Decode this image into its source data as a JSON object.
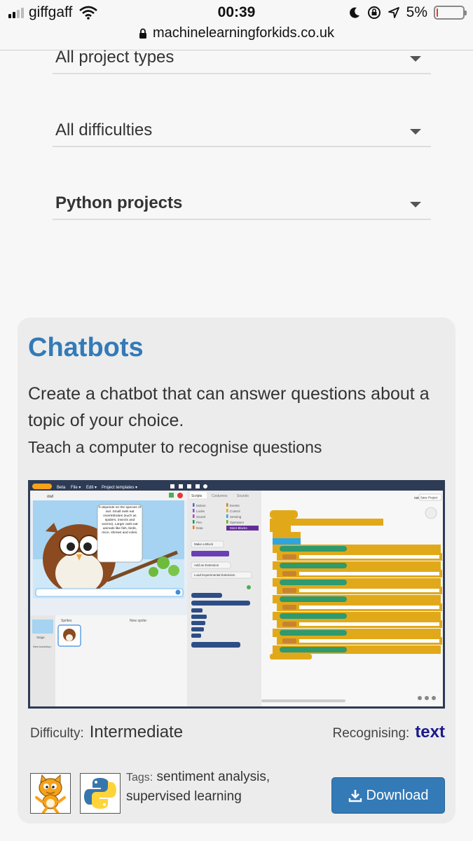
{
  "status": {
    "carrier": "giffgaff",
    "time": "00:39",
    "battery": "5%",
    "battery_level": 0.05,
    "url": "machinelearningforkids.co.uk"
  },
  "filters": [
    {
      "label": "All project types"
    },
    {
      "label": "All difficulties"
    },
    {
      "label": "Python projects"
    }
  ],
  "card": {
    "title": "Chatbots",
    "summary": "Create a chatbot that can answer questions about a topic of your choice.",
    "description": "Teach a computer to recognise questions",
    "difficulty_label": "Difficulty:",
    "difficulty": "Intermediate",
    "recognising_label": "Recognising:",
    "recognising": "text",
    "tags_label": "Tags:",
    "tags_line1": "sentiment analysis,",
    "tags_line2": "supervised learning",
    "download_label": "Download",
    "accent_color": "#337ab7"
  },
  "screenshot": {
    "menu": [
      "Beta",
      "File ▾",
      "Edit ▾",
      "Project templates ▾"
    ],
    "tabs": [
      "Scripts",
      "Costumes",
      "Sounds"
    ],
    "sprite_name": "owl",
    "owls_label": "owls",
    "save_label": "Save Project",
    "speech": "It depends on the species of owl. Small owls eat invertebrates (such as spiders, insects and worms). Larger owls eat animals like fish, birds, mice, shrews and voles.",
    "categories_left": [
      "Motion",
      "Looks",
      "Sound",
      "Pen",
      "Data"
    ],
    "categories_right": [
      "Events",
      "Control",
      "Sensing",
      "Operators",
      "More Blocks"
    ],
    "palette_buttons": [
      "Make a Block",
      "Add an Extension",
      "Load Experimental Extension"
    ],
    "sprites_label": "Sprites",
    "new_sprite_label": "New sprite:",
    "stage_label": "Stage",
    "new_backdrop_label": "New backdrop:"
  }
}
